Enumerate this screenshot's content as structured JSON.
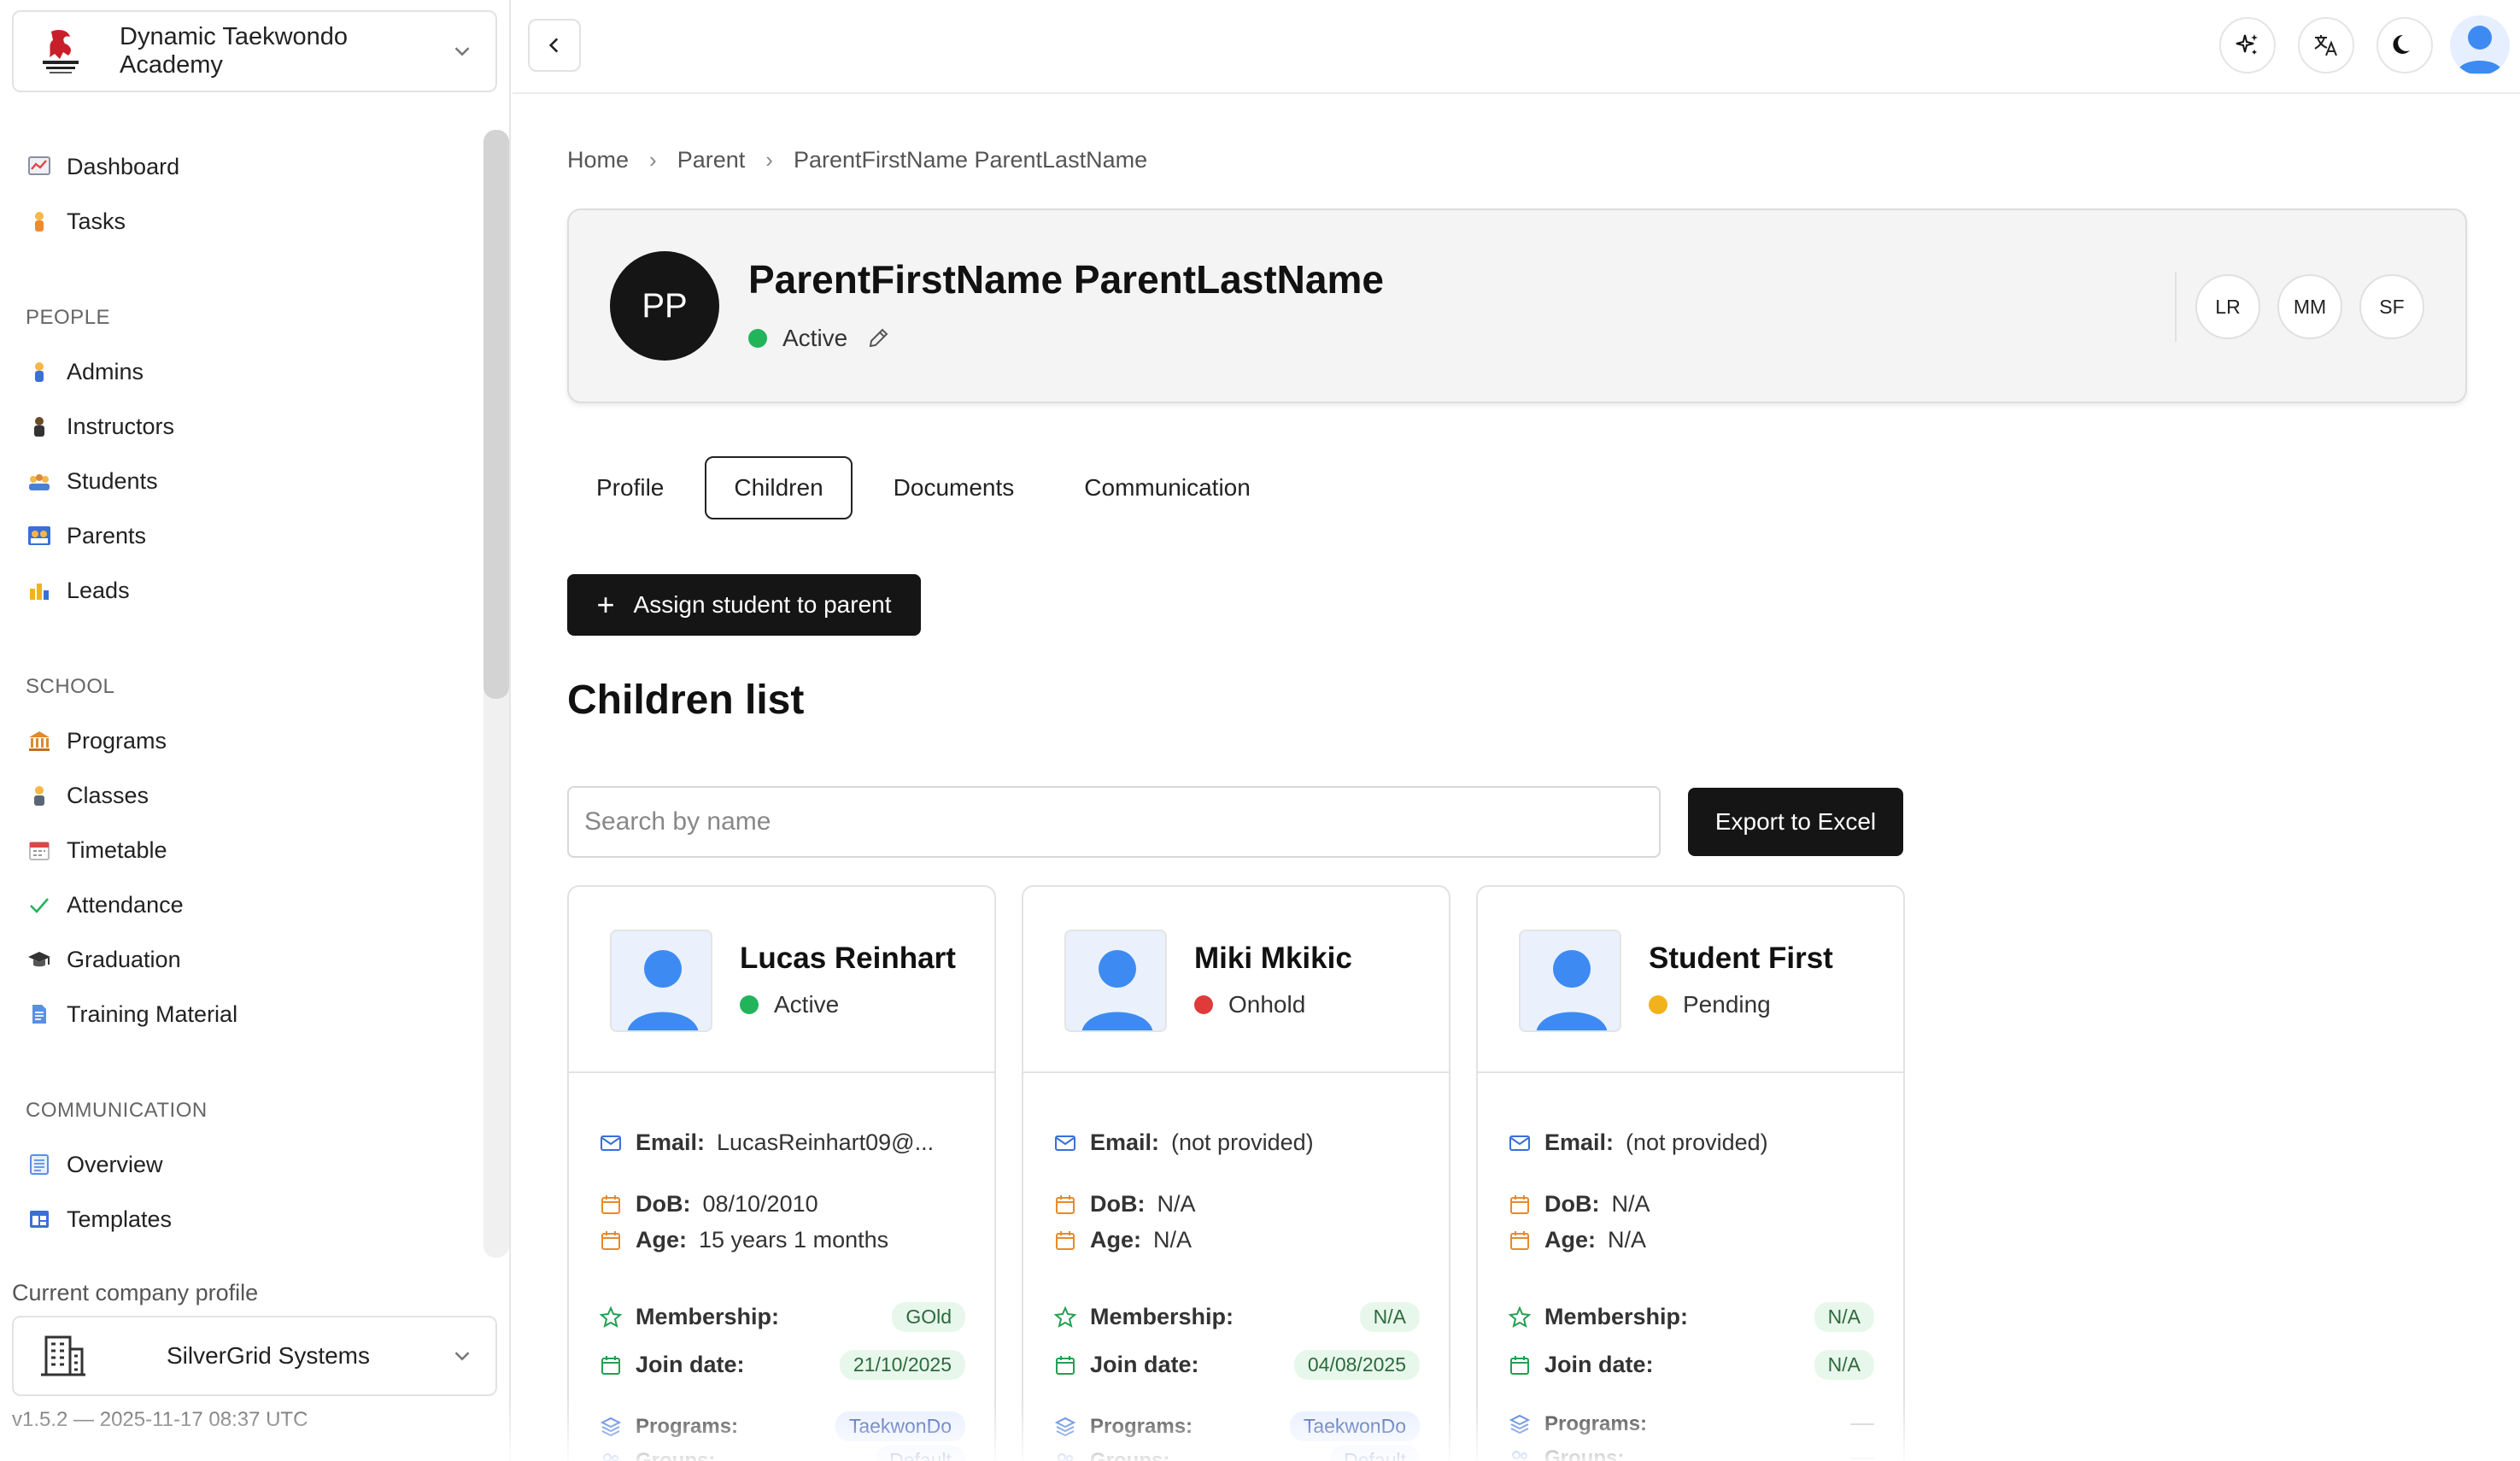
{
  "sidebar": {
    "org_name": "Dynamic Taekwondo Academy",
    "main_items": [
      {
        "label": "Dashboard",
        "icon": "dashboard-icon"
      },
      {
        "label": "Tasks",
        "icon": "tasks-icon"
      }
    ],
    "people_title": "PEOPLE",
    "people_items": [
      {
        "label": "Admins",
        "icon": "admins-icon"
      },
      {
        "label": "Instructors",
        "icon": "instructors-icon"
      },
      {
        "label": "Students",
        "icon": "students-icon"
      },
      {
        "label": "Parents",
        "icon": "parents-icon"
      },
      {
        "label": "Leads",
        "icon": "leads-icon"
      }
    ],
    "school_title": "SCHOOL",
    "school_items": [
      {
        "label": "Programs",
        "icon": "programs-icon"
      },
      {
        "label": "Classes",
        "icon": "classes-icon"
      },
      {
        "label": "Timetable",
        "icon": "timetable-icon"
      },
      {
        "label": "Attendance",
        "icon": "attendance-icon"
      },
      {
        "label": "Graduation",
        "icon": "graduation-icon"
      },
      {
        "label": "Training Material",
        "icon": "training-material-icon"
      }
    ],
    "communication_title": "COMMUNICATION",
    "communication_items": [
      {
        "label": "Overview",
        "icon": "overview-icon"
      },
      {
        "label": "Templates",
        "icon": "templates-icon"
      }
    ],
    "company_label": "Current company profile",
    "company_name": "SilverGrid Systems",
    "version": "v1.5.2 — 2025-11-17 08:37 UTC"
  },
  "breadcrumb": [
    "Home",
    "Parent",
    "ParentFirstName ParentLastName"
  ],
  "parent": {
    "initials": "PP",
    "name": "ParentFirstName ParentLastName",
    "status": "Active",
    "child_initials": [
      "LR",
      "MM",
      "SF"
    ]
  },
  "tabs": [
    "Profile",
    "Children",
    "Documents",
    "Communication"
  ],
  "assign_button": "Assign student to parent",
  "section_title": "Children list",
  "search": {
    "placeholder": "Search by name"
  },
  "export_button": "Export to Excel",
  "labels": {
    "email": "Email:",
    "dob": "DoB:",
    "age": "Age:",
    "membership": "Membership:",
    "join_date": "Join date:",
    "programs": "Programs:",
    "groups": "Groups:"
  },
  "children": [
    {
      "name": "Lucas Reinhart",
      "status": "Active",
      "email": "LucasReinhart09@...",
      "dob": "08/10/2010",
      "age": "15 years 1 months",
      "membership": "GOld",
      "join_date": "21/10/2025",
      "programs": "TaekwonDo",
      "groups": "Default"
    },
    {
      "name": "Miki Mkikic",
      "status": "Onhold",
      "email": "(not provided)",
      "dob": "N/A",
      "age": "N/A",
      "membership": "N/A",
      "join_date": "04/08/2025",
      "programs": "TaekwonDo",
      "groups": "Default"
    },
    {
      "name": "Student First",
      "status": "Pending",
      "email": "(not provided)",
      "dob": "N/A",
      "age": "N/A",
      "membership": "N/A",
      "join_date": "N/A",
      "programs": "",
      "groups": ""
    }
  ],
  "colors": {
    "active": "#22b45a",
    "onhold": "#e03a3a",
    "pending": "#f2b21c",
    "primary_button": "#151515",
    "avatar_blue": "#3d8bf2"
  }
}
